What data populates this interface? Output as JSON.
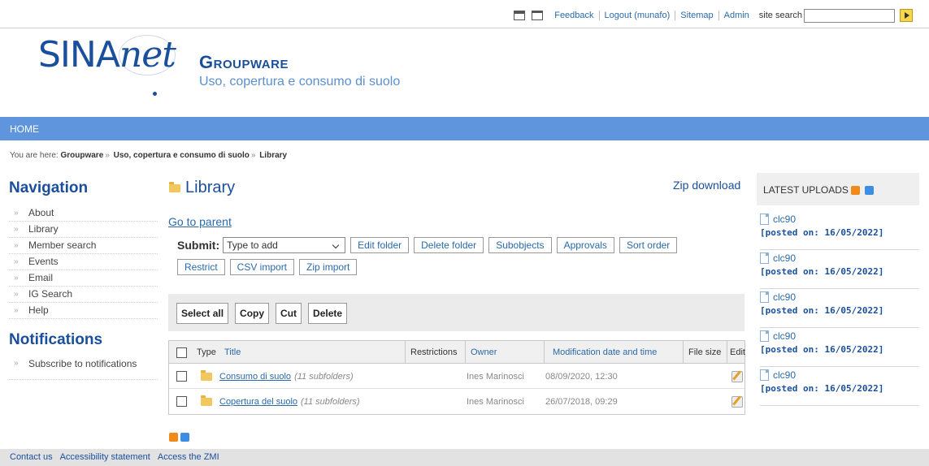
{
  "topbar": {
    "links": [
      "Feedback",
      "Logout (munafo)",
      "Sitemap",
      "Admin"
    ],
    "search_label": "site search",
    "search_value": ""
  },
  "header": {
    "logo_text_a": "SINA",
    "logo_text_b": "net",
    "title": "Groupware",
    "subtitle": "Uso, copertura e consumo di suolo"
  },
  "navbar": {
    "home": "HOME"
  },
  "breadcrumb": {
    "prefix": "You are here:",
    "items": [
      "Groupware",
      "Uso, copertura e consumo di suolo",
      "Library"
    ],
    "separator": "»"
  },
  "sidebar": {
    "navigation_title": "Navigation",
    "items": [
      "About",
      "Library",
      "Member search",
      "Events",
      "Email",
      "IG Search",
      "Help"
    ],
    "notifications_title": "Notifications",
    "notification_items": [
      "Subscribe to notifications"
    ]
  },
  "main": {
    "title": "Library",
    "zip_download": "Zip download",
    "go_to_parent": "Go to parent",
    "submit_label": "Submit:",
    "submit_select": "Type to add",
    "buttons_row1": [
      "Edit folder",
      "Delete folder",
      "Subobjects",
      "Approvals",
      "Sort order"
    ],
    "buttons_row2": [
      "Restrict",
      "CSV import",
      "Zip import"
    ],
    "actions": [
      "Select all",
      "Copy",
      "Cut",
      "Delete"
    ],
    "table": {
      "headers": [
        "Type",
        "Title",
        "Restrictions",
        "Owner",
        "Modification date and time",
        "File size",
        "Edit"
      ],
      "rows": [
        {
          "title": "Consumo di suolo",
          "count": "(11 subfolders)",
          "owner": "Ines Marinosci",
          "modified": "08/09/2020, 12:30"
        },
        {
          "title": "Copertura del suolo",
          "count": "(11 subfolders)",
          "owner": "Ines Marinosci",
          "modified": "26/07/2018, 09:29"
        }
      ]
    }
  },
  "right": {
    "title": "LATEST UPLOADS",
    "items": [
      {
        "name": "clc90",
        "date": "[posted on: 16/05/2022]"
      },
      {
        "name": "clc90",
        "date": "[posted on: 16/05/2022]"
      },
      {
        "name": "clc90",
        "date": "[posted on: 16/05/2022]"
      },
      {
        "name": "clc90",
        "date": "[posted on: 16/05/2022]"
      },
      {
        "name": "clc90",
        "date": "[posted on: 16/05/2022]"
      }
    ]
  },
  "footer": {
    "links": [
      "Contact us",
      "Accessibility statement",
      "Access the ZMI"
    ]
  },
  "colors": {
    "accent": "#1a4f9c",
    "navbar": "#5f95dc",
    "link": "#2a6aa8"
  }
}
